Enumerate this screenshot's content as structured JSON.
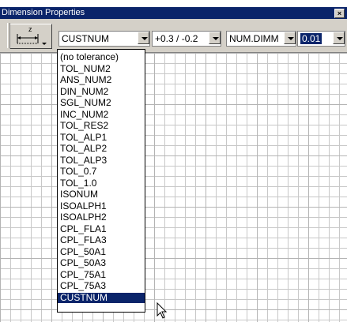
{
  "window": {
    "title": "Dimension Properties",
    "close_glyph": "×"
  },
  "background_title_fragment": "...",
  "toolbar": {
    "dimension_button_icon": "dimension-z-icon",
    "dimension_button_label": "z",
    "tolerance_style": {
      "value": "CUSTNUM"
    },
    "tolerance_value": {
      "value": "+0.3 / -0.2"
    },
    "dim_format": {
      "value": "NUM.DIMM"
    },
    "precision": {
      "value": "0.01"
    }
  },
  "tolerance_options": [
    "(no tolerance)",
    "TOL_NUM2",
    "ANS_NUM2",
    "DIN_NUM2",
    "SGL_NUM2",
    "INC_NUM2",
    "TOL_RES2",
    "TOL_ALP1",
    "TOL_ALP2",
    "TOL_ALP3",
    "TOL_0.7",
    "TOL_1.0",
    "ISONUM",
    "ISOALPH1",
    "ISOALPH2",
    "CPL_FLA1",
    "CPL_FLA3",
    "CPL_50A1",
    "CPL_50A3",
    "CPL_75A1",
    "CPL_75A3",
    "CUSTNUM"
  ],
  "selected_option_index": 21,
  "colors": {
    "titlebar": "#0a246a",
    "face": "#d4d0c8",
    "highlight": "#0a246a"
  }
}
